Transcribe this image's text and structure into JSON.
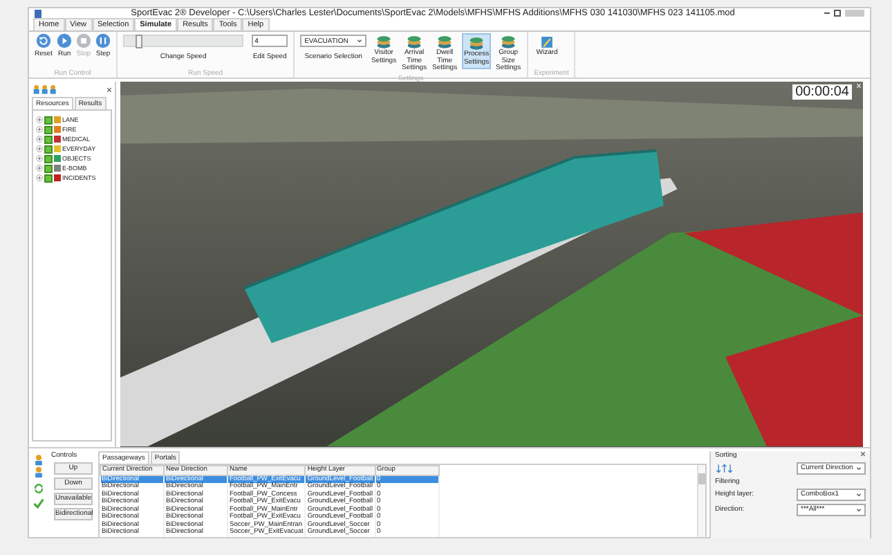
{
  "window": {
    "title": "SportEvac 2® Developer -  C:\\Users\\Charles Lester\\Documents\\SportEvac 2\\Models\\MFHS\\MFHS Additions\\MFHS 030 141030\\MFHS 023  141105.mod"
  },
  "tabs": [
    {
      "label": "Home",
      "selected": false
    },
    {
      "label": "View",
      "selected": false
    },
    {
      "label": "Selection",
      "selected": false
    },
    {
      "label": "Simulate",
      "selected": true
    },
    {
      "label": "Results",
      "selected": false
    },
    {
      "label": "Tools",
      "selected": false
    },
    {
      "label": "Help",
      "selected": false
    }
  ],
  "run_control": {
    "label": "Run Control",
    "buttons": [
      {
        "label": "Reset",
        "kind": "reset",
        "disabled": false
      },
      {
        "label": "Run",
        "kind": "run",
        "disabled": false
      },
      {
        "label": "Stop",
        "kind": "stop",
        "disabled": true
      },
      {
        "label": "Step",
        "kind": "step",
        "disabled": false
      }
    ]
  },
  "run_speed": {
    "label": "Run Speed",
    "slider": {
      "label": "Change Speed",
      "level": 0.12
    },
    "speed_input": {
      "value": "4",
      "label": "Edit Speed"
    }
  },
  "settings": {
    "label": "Settings",
    "scenario": {
      "value": "EVACUATION",
      "label": "Scenario Selection"
    },
    "buttons": [
      {
        "label": "Visitor Settings",
        "selected": false
      },
      {
        "label": "Arrival Time Settings",
        "selected": false
      },
      {
        "label": "Dwell Time Settings",
        "selected": false
      },
      {
        "label": "Process Settings",
        "selected": true
      },
      {
        "label": "Group Size Settings",
        "selected": false
      }
    ]
  },
  "experiment": {
    "label": "Experiment",
    "buttons": [
      {
        "label": "Wizard"
      }
    ]
  },
  "sidebar": {
    "tabs": [
      {
        "label": "Resources",
        "selected": true
      },
      {
        "label": "Results",
        "selected": false
      }
    ],
    "items": [
      {
        "label": "LANE",
        "checked": true,
        "color": "#e0a020"
      },
      {
        "label": "FIRE",
        "checked": true,
        "color": "#e08020"
      },
      {
        "label": "MEDICAL",
        "checked": true,
        "color": "#c03030"
      },
      {
        "label": "EVERYDAY",
        "checked": true,
        "color": "#e0c030"
      },
      {
        "label": "OBJECTS",
        "checked": true,
        "color": "#30a060"
      },
      {
        "label": "E-BOMB",
        "checked": true,
        "color": "#808080"
      },
      {
        "label": "INCIDENTS",
        "checked": true,
        "color": "#c02020"
      }
    ]
  },
  "viewport": {
    "timer": "00:00:04"
  },
  "controls": {
    "label": "Controls",
    "buttons": [
      "Up",
      "Down",
      "Unavailable",
      "Bidirectional"
    ]
  },
  "table": {
    "tabs": [
      {
        "label": "Passageways",
        "selected": true
      },
      {
        "label": "Portals",
        "selected": false
      }
    ],
    "columns": [
      "Current Direction",
      "New Direction",
      "Name",
      "Height Layer",
      "Group"
    ],
    "rows": [
      {
        "cells": [
          "BiDirectional",
          "BiDirectional",
          "Football_PW_ExitEvacu",
          "GroundLevel_Football",
          "0"
        ],
        "selected": true
      },
      {
        "cells": [
          "BiDirectional",
          "BiDirectional",
          "Football_PW_MainEntr",
          "GroundLevel_Football",
          "0"
        ],
        "selected": false
      },
      {
        "cells": [
          "BiDirectional",
          "BiDirectional",
          "Football_PW_Concess",
          "GroundLevel_Football",
          "0"
        ],
        "selected": false
      },
      {
        "cells": [
          "BiDirectional",
          "BiDirectional",
          "Football_PW_ExitEvacu",
          "GroundLevel_Football",
          "0"
        ],
        "selected": false
      },
      {
        "cells": [
          "BiDirectional",
          "BiDirectional",
          "Football_PW_MainEntr",
          "GroundLevel_Football",
          "0"
        ],
        "selected": false
      },
      {
        "cells": [
          "BiDirectional",
          "BiDirectional",
          "Football_PW_ExitEvacu",
          "GroundLevel_Football",
          "0"
        ],
        "selected": false
      },
      {
        "cells": [
          "BiDirectional",
          "BiDirectional",
          "Soccer_PW_MainEntran",
          "GroundLevel_Soccer",
          "0"
        ],
        "selected": false
      },
      {
        "cells": [
          "BiDirectional",
          "BiDirectional",
          "Soccer_PW_ExitEvacuat",
          "GroundLevel_Soccer",
          "0"
        ],
        "selected": false
      }
    ]
  },
  "side_panel": {
    "sorting_label": "Sorting",
    "sort_value": "Current Direction",
    "filtering_label": "Filtering",
    "filters": [
      {
        "label": "Height layer:",
        "value": "ComboBox1"
      },
      {
        "label": "Direction:",
        "value": "***All***"
      }
    ]
  }
}
